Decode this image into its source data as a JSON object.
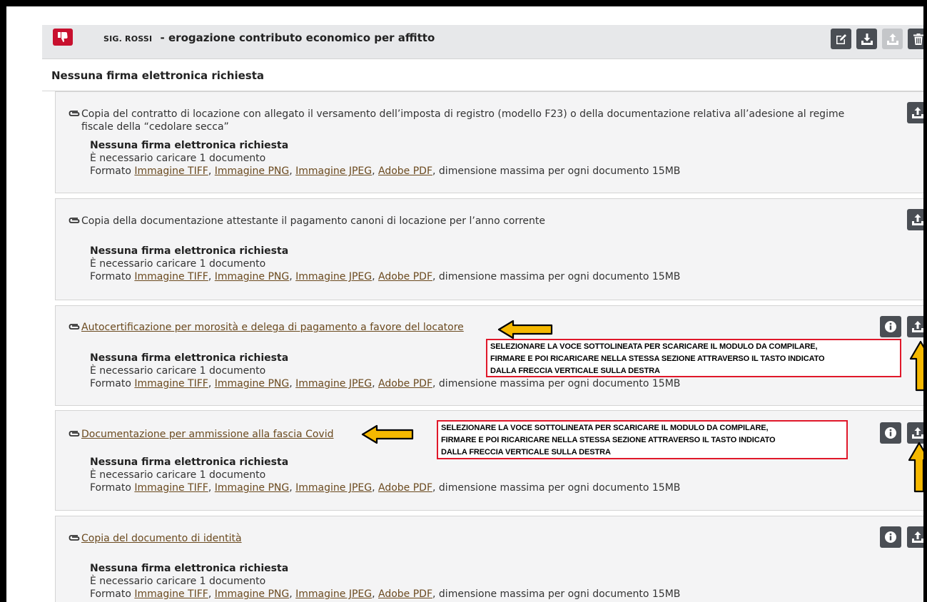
{
  "header": {
    "name": "SIG. ROSSI",
    "title": " - erogazione contributo economico per affitto",
    "buttons": [
      "edit-icon",
      "download-icon",
      "upload-icon",
      "trash-icon"
    ]
  },
  "subheader": "Nessuna firma elettronica richiesta",
  "labels": {
    "no_signature": "Nessuna firma elettronica richiesta",
    "required": "È necessario caricare 1 documento",
    "format_prefix": "Formato ",
    "formats": [
      "Immagine TIFF",
      "Immagine PNG",
      "Immagine JPEG",
      "Adobe PDF"
    ],
    "sep": ", ",
    "format_suffix": ", dimensione massima per ogni documento 15MB"
  },
  "documents": [
    {
      "title": "Copia del contratto di locazione con allegato il versamento dell’imposta di registro (modello F23) o della documentazione relativa all’adesione al regime fiscale della “cedolare secca”",
      "linked": false,
      "info_button": false
    },
    {
      "title": "Copia della documentazione attestante il pagamento canoni di locazione per l’anno corrente",
      "linked": false,
      "info_button": false
    },
    {
      "title": "Autocertificazione per morosità e delega di pagamento a favore del locatore",
      "linked": true,
      "info_button": true
    },
    {
      "title": "Documentazione per ammissione alla fascia Covid",
      "linked": true,
      "info_button": true
    },
    {
      "title": "Copia del documento di identità",
      "linked": true,
      "info_button": true
    }
  ],
  "annotations": {
    "line1": "SELEZIONARE LA VOCE SOTTOLINEATA PER SCARICARE IL MODULO DA COMPILARE,",
    "line2": "FIRMARE E POI RICARICARE NELLA STESSA SEZIONE ATTRAVERSO IL TASTO INDICATO",
    "line3": " DALLA FRECCIA VERTICALE SULLA  DESTRA"
  },
  "colors": {
    "accent_red": "#c8102e",
    "button_dark": "#4a4e54",
    "link_brown": "#6b4a1f",
    "arrow_yellow": "#f5b800"
  }
}
